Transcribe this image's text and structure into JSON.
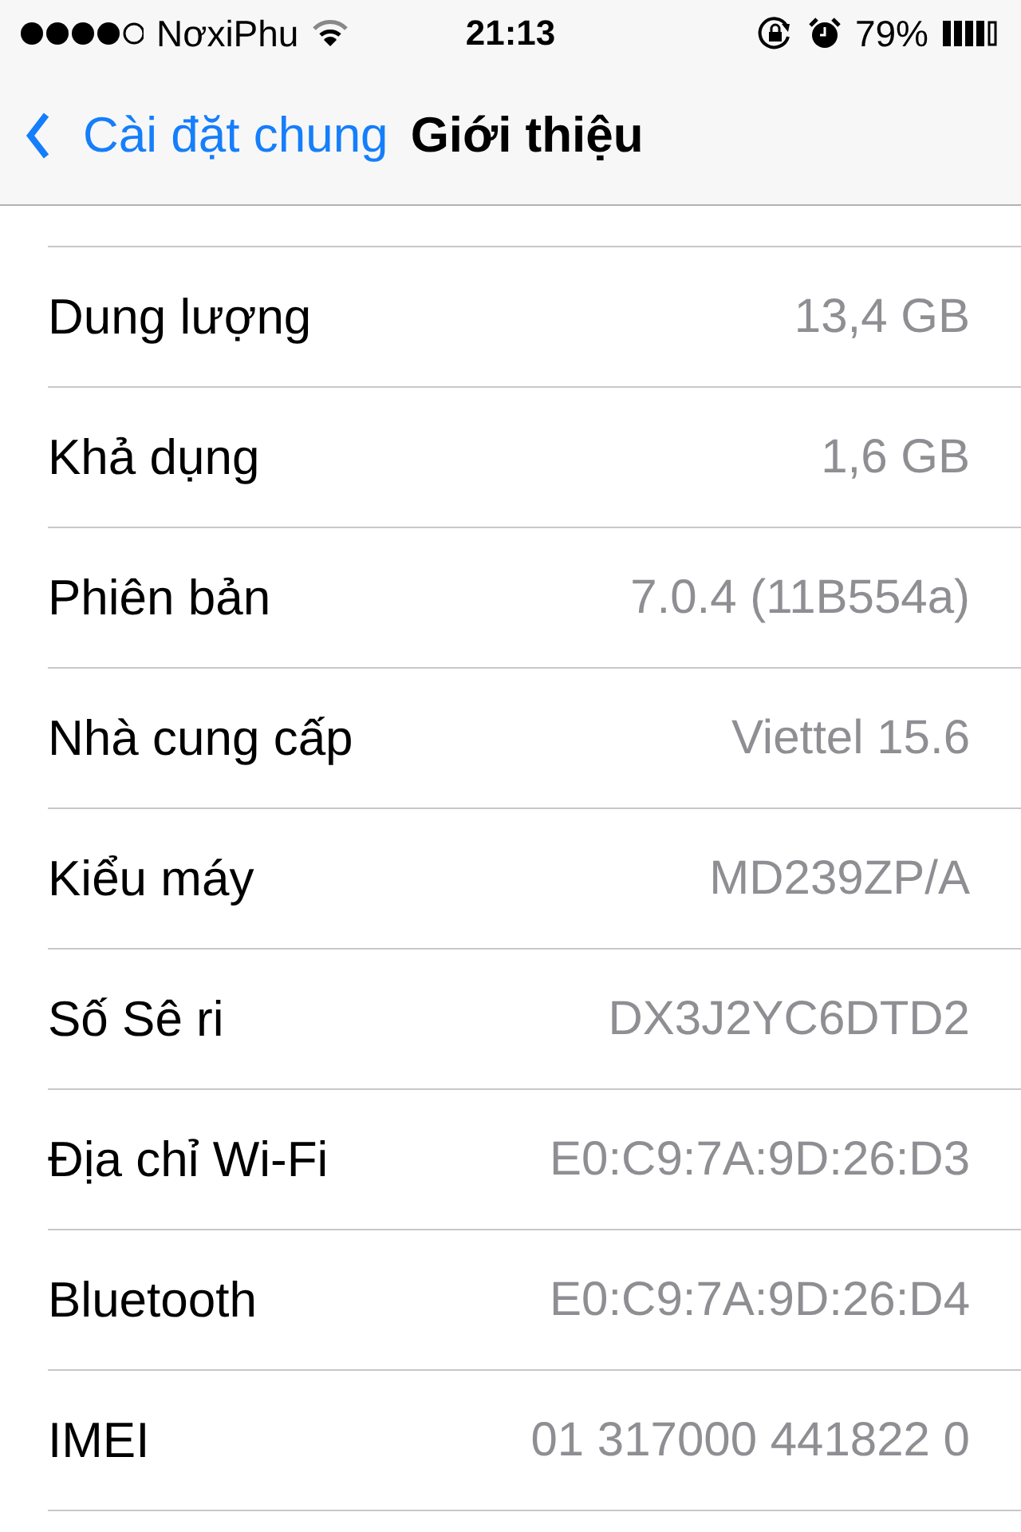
{
  "status_bar": {
    "carrier": "NơxiPhu",
    "time": "21:13",
    "battery": "79%"
  },
  "nav": {
    "back": "Cài đặt chung",
    "title": "Giới thiệu"
  },
  "rows": [
    {
      "label": "Dung lượng",
      "value": "13,4 GB"
    },
    {
      "label": "Khả dụng",
      "value": "1,6 GB"
    },
    {
      "label": "Phiên bản",
      "value": "7.0.4 (11B554a)"
    },
    {
      "label": "Nhà cung cấp",
      "value": "Viettel 15.6"
    },
    {
      "label": "Kiểu máy",
      "value": "MD239ZP/A"
    },
    {
      "label": "Số Sê ri",
      "value": "DX3J2YC6DTD2"
    },
    {
      "label": "Địa chỉ Wi-Fi",
      "value": "E0:C9:7A:9D:26:D3"
    },
    {
      "label": "Bluetooth",
      "value": "E0:C9:7A:9D:26:D4"
    },
    {
      "label": "IMEI",
      "value": "01 317000 441822 0"
    }
  ]
}
